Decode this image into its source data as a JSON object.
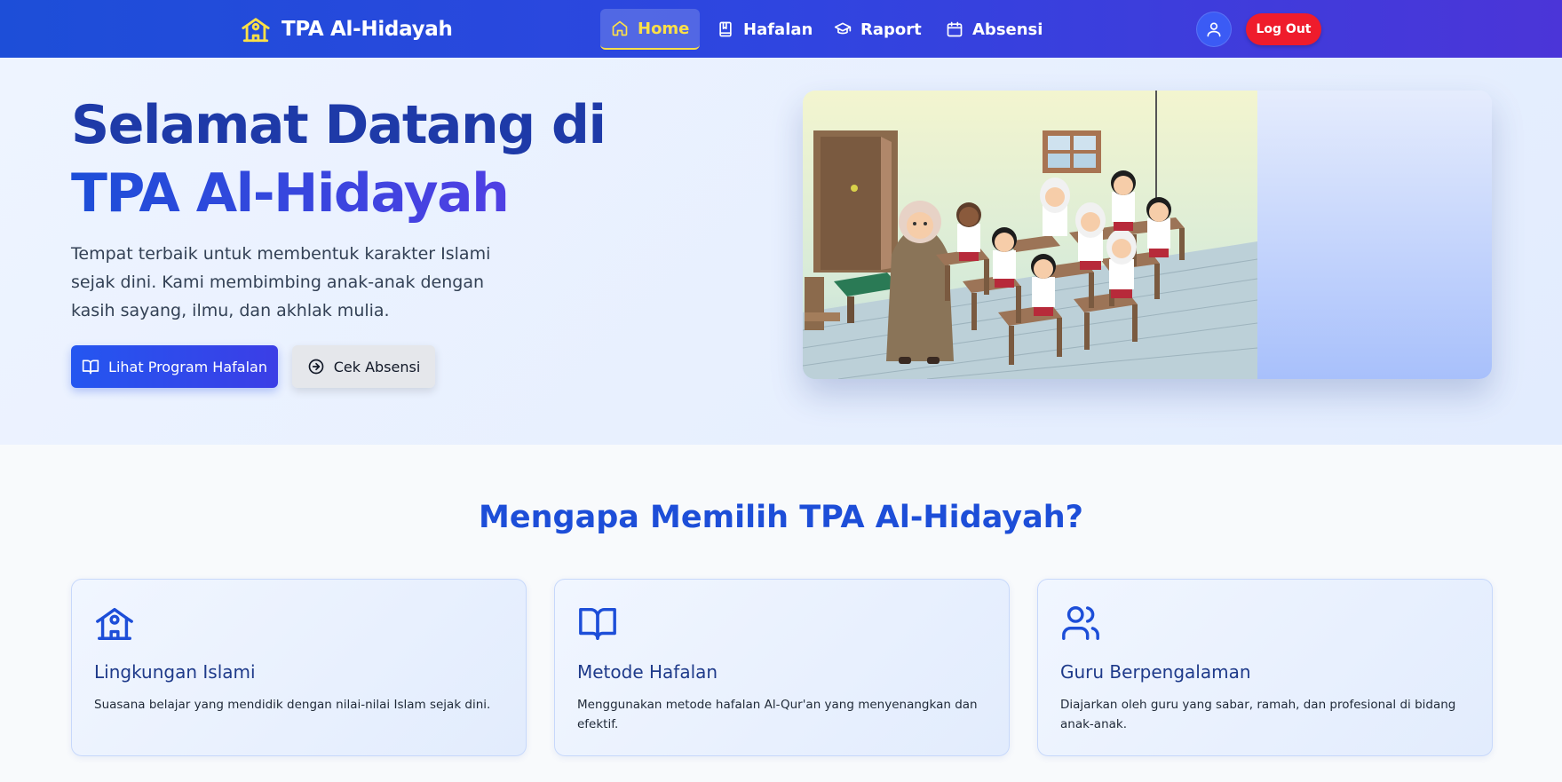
{
  "nav": {
    "brand": "TPA Al-Hidayah",
    "items": [
      {
        "label": "Home",
        "icon": "home-icon",
        "active": true
      },
      {
        "label": "Hafalan",
        "icon": "book-icon"
      },
      {
        "label": "Raport",
        "icon": "graduation-cap-icon"
      },
      {
        "label": "Absensi",
        "icon": "calendar-icon"
      }
    ],
    "logout": "Log Out"
  },
  "hero": {
    "title_line1": "Selamat Datang di",
    "title_line2": "TPA Al-Hidayah",
    "description": "Tempat terbaik untuk membentuk karakter Islami sejak dini. Kami membimbing anak-anak dengan kasih sayang, ilmu, dan akhlak mulia.",
    "primary_button": "Lihat Program Hafalan",
    "secondary_button": "Cek Absensi"
  },
  "features": {
    "title": "Mengapa Memilih TPA Al-Hidayah?",
    "cards": [
      {
        "icon": "school-icon",
        "title": "Lingkungan Islami",
        "desc": "Suasana belajar yang mendidik dengan nilai-nilai Islam sejak dini."
      },
      {
        "icon": "open-book-icon",
        "title": "Metode Hafalan",
        "desc": "Menggunakan metode hafalan Al-Qur'an yang menyenangkan dan efektif."
      },
      {
        "icon": "users-icon",
        "title": "Guru Berpengalaman",
        "desc": "Diajarkan oleh guru yang sabar, ramah, dan profesional di bidang anak-anak."
      }
    ]
  },
  "colors": {
    "primary": "#1d4ed8",
    "accent": "#fde047",
    "danger": "#ef1c2c"
  }
}
